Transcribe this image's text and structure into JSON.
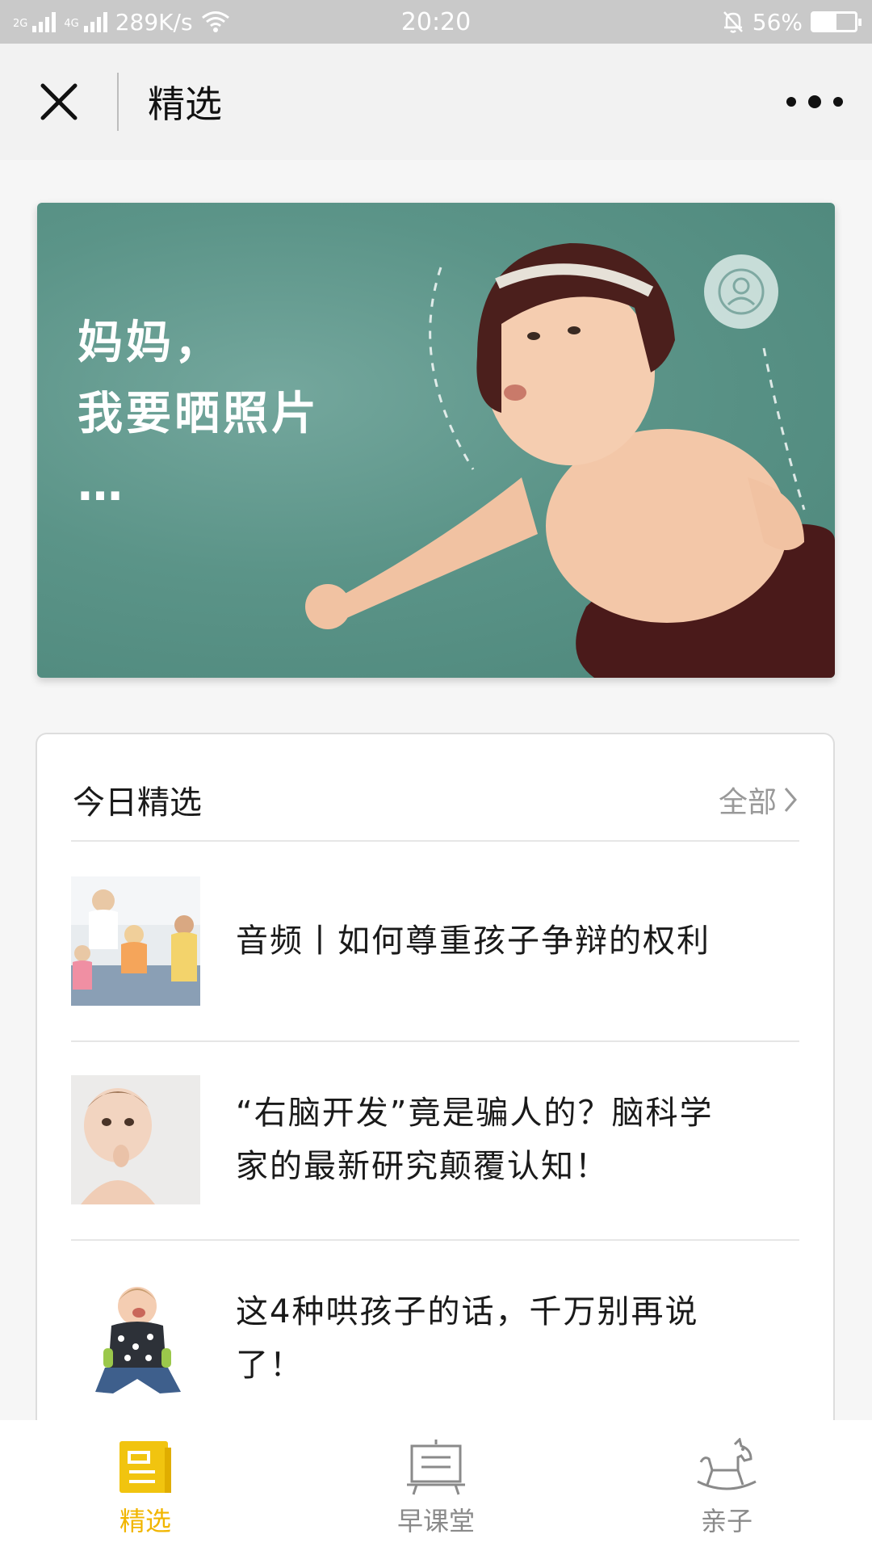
{
  "status_bar": {
    "network_left": "2G",
    "network_right": "4G",
    "speed": "289K/s",
    "time": "20:20",
    "battery_percent": "56%",
    "battery_level": 0.56
  },
  "nav": {
    "title": "精选",
    "close_icon": "close-icon",
    "more_icon": "more-icon"
  },
  "banner": {
    "line1": "妈妈，",
    "line2": "我要晒照片",
    "line3": "…"
  },
  "section": {
    "title": "今日精选",
    "see_all": "全部"
  },
  "articles": [
    {
      "title": "音频丨如何尊重孩子争辩的权利"
    },
    {
      "title": "“右脑开发”竟是骗人的？脑科学家的最新研究颠覆认知！"
    },
    {
      "title": "这4种哄孩子的话，千万别再说了！"
    }
  ],
  "tabs": [
    {
      "label": "精选",
      "icon": "featured-icon",
      "active": true
    },
    {
      "label": "早课堂",
      "icon": "blackboard-icon",
      "active": false
    },
    {
      "label": "亲子",
      "icon": "rocking-horse-icon",
      "active": false
    }
  ],
  "colors": {
    "accent": "#f1b600",
    "banner_bg": "#5b9488",
    "inactive_tab": "#8a8a8a"
  }
}
